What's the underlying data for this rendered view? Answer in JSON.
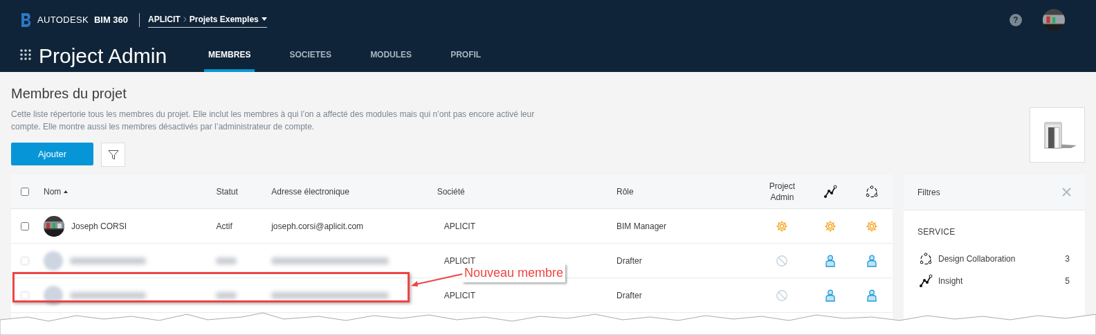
{
  "header": {
    "brand": "AUTODESK",
    "product": "BIM 360",
    "breadcrumb": [
      "APLICIT",
      "Projets Exemples"
    ],
    "help": "?"
  },
  "app": {
    "title": "Project Admin",
    "tabs": [
      {
        "label": "MEMBRES",
        "selected": true
      },
      {
        "label": "SOCIETES",
        "selected": false
      },
      {
        "label": "MODULES",
        "selected": false
      },
      {
        "label": "PROFIL",
        "selected": false
      }
    ]
  },
  "page": {
    "title": "Membres du projet",
    "description": "Cette liste répertorie tous les membres du projet. Elle inclut les membres à qui l’on a affecté des modules mais qui n’ont pas encore activé leur compte. Elle montre aussi les membres désactivés par l’administrateur de compte.",
    "add_button": "Ajouter"
  },
  "table": {
    "select_all_checked": false,
    "columns": [
      "Nom",
      "Statut",
      "Adresse électronique",
      "Société",
      "Rôle",
      "Project Admin"
    ],
    "rows": [
      {
        "blurred": false,
        "checked": false,
        "name": "Joseph CORSI",
        "status": "Actif",
        "email": "joseph.corsi@aplicit.com",
        "company": "APLICIT",
        "role": "BIM Manager",
        "access": [
          {
            "kind": "admin"
          },
          {
            "kind": "admin"
          },
          {
            "kind": "admin"
          }
        ]
      },
      {
        "blurred": true,
        "checked": false,
        "company": "APLICIT",
        "role": "Drafter",
        "access": [
          {
            "kind": "none"
          },
          {
            "kind": "member"
          },
          {
            "kind": "member"
          }
        ]
      },
      {
        "blurred": true,
        "checked": false,
        "company": "APLICIT",
        "role": "Drafter",
        "access": [
          {
            "kind": "none"
          },
          {
            "kind": "member"
          },
          {
            "kind": "member"
          }
        ]
      }
    ]
  },
  "annotation": {
    "label": "Nouveau membre"
  },
  "filters": {
    "title": "Filtres",
    "section": "SERVICE",
    "items": [
      {
        "kind": "collab",
        "label": "Design Collaboration",
        "count": "3"
      },
      {
        "kind": "insight",
        "label": "Insight",
        "count": "5"
      }
    ]
  }
}
